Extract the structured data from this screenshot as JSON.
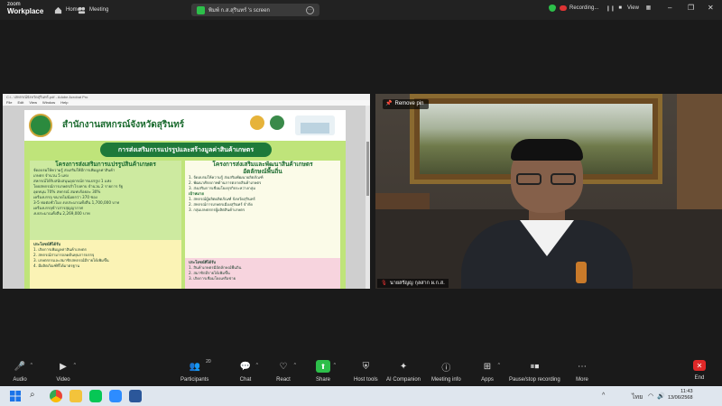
{
  "titlebar": {
    "logo_line1": "zoom",
    "logo_line2": "Workplace",
    "tab_home": "Home",
    "tab_meeting": "Meeting",
    "tab_screen": "พิมพ์ ก.ส.สุรินทร์ 's screen",
    "recording": "Recording...",
    "view": "View"
  },
  "pdf": {
    "window_title": "C:\\...\\สหกรณ์จังหวัดสุรินทร์.pdf - Adobe Acrobat Pro",
    "menu": [
      "File",
      "Edit",
      "View",
      "Window",
      "Help"
    ],
    "org_title": "สำนักงานสหกรณ์จังหวัดสุรินทร์",
    "banner": "การส่งเสริมการแปรรูปและสร้างมูลค่าสินค้าเกษตร",
    "left_heading": "โครงการส่งเสริมการแปรรูปสินค้าเกษตร",
    "right_heading": "โครงการส่งเสริมและพัฒนาสินค้าเกษตร",
    "right_subheading": "อัตลักษณ์พื้นถิ่น",
    "left_lines": [
      "จัดอบรมให้ความรู้ ส่งเสริมให้มีการเพิ่มมูลค่าสินค้า",
      "เกษตร  จำนวน 5 แห่ง",
      "สหกรณ์ได้รับสนับสนุนอุปกรณ์การแปรรูป 1 แห่ง",
      "โดยสหกรณ์การเกษตรสำโรงทาบ จำนวน 2 รายการ รัฐ",
      "อุดหนุน 70% สหกรณ์ สมทบร้อยละ 30%",
      "เครื่องบรรจุ ขนาดไม่น้อยกว่า 370 ซอง",
      "3-5 ห่อต่อชั่วโมง งบประมาณทั้งสิ้น 1,700,000 บาท",
      "เครื่องบรรจุข้าวสารสุญญากาศ",
      "งบประมาณทั้งสิ้น 2,269,000 บาท"
    ],
    "left_benefit_heading": "ประโยชน์ที่ได้รับ",
    "left_benefits": [
      "1. เกิดการเพิ่มมูลค่าสินค้าเกษตร",
      "2. สหกรณ์สามารถลดต้นทุนการบรรจุ",
      "3. เกษตรกรและสมาชิกสหกรณ์มีรายได้เพิ่มขึ้น",
      "4. มีผลิตภัณฑ์ที่ได้มาตรฐาน"
    ],
    "right_lines": [
      "1. จัดอบรมให้ความรู้ ส่งเสริมพัฒนาผลิตภัณฑ์",
      "2. พัฒนาศักยภาพด้านการตลาดสินค้าเกษตร",
      "3. ส่งเสริมการเชื่อมโยงธุรกิจระหว่างกลุ่ม"
    ],
    "right_target_heading": "เป้าหมาย",
    "right_targets": [
      "1. สหกรณ์ผู้ผลิตผลิตภัณฑ์ จังหวัดสุรินทร์",
      "2. สหกรณ์การเกษตรเมืองสุรินทร์ จำกัด",
      "3. กลุ่มเกษตรกรผู้ผลิตสินค้าเกษตร"
    ],
    "right_benefit_heading": "ประโยชน์ที่ได้รับ",
    "right_benefits": [
      "1. สินค้าเกษตรมีอัตลักษณ์พื้นถิ่น",
      "2. สมาชิกมีรายได้เพิ่มขึ้น",
      "3. เกิดการเชื่อมโยงเครือข่าย"
    ]
  },
  "video": {
    "remove_pin": "Remove pin",
    "participant_name": "นายสรัญญ กุลสาก ผ.ก.ส."
  },
  "toolbar": {
    "audio": "Audio",
    "video": "Video",
    "participants": "Participants",
    "participants_count": "20",
    "chat": "Chat",
    "react": "React",
    "share": "Share",
    "host_tools": "Host tools",
    "ai_companion": "AI Companion",
    "meeting_info": "Meeting info",
    "apps": "Apps",
    "pause_stop": "Pause/stop recording",
    "more": "More",
    "end": "End"
  },
  "taskbar": {
    "lang": "ไทย",
    "time": "11:43",
    "date": "13/06/2568"
  },
  "colors": {
    "share_accent": "#1e7a3a",
    "page_bg": "#bfe47a",
    "recording_red": "#d33333",
    "share_green": "#2dbf4a",
    "end_red": "#e02828"
  }
}
